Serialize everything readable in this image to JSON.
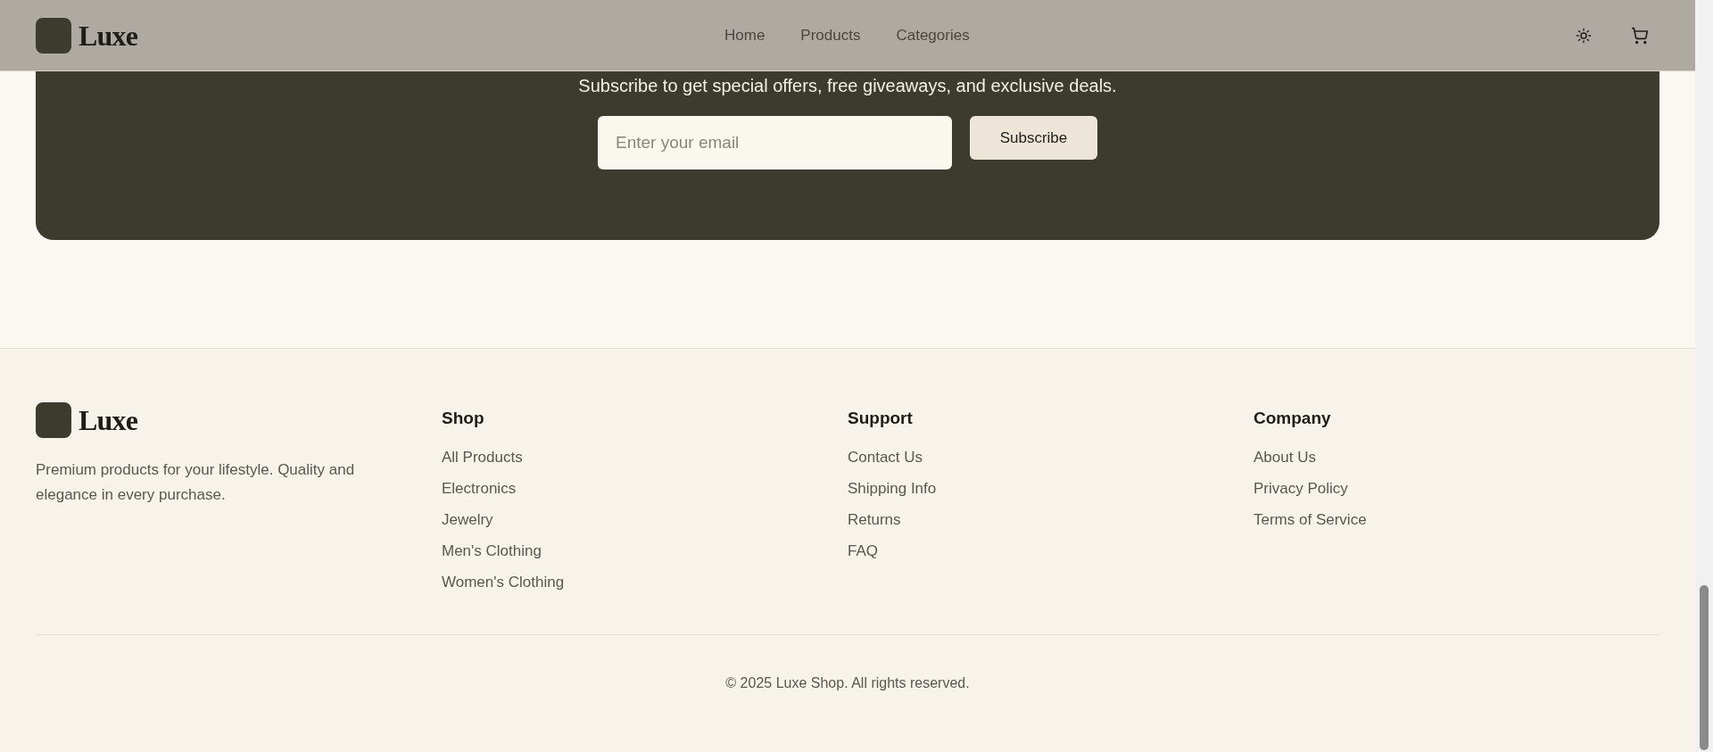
{
  "header": {
    "logo": "Luxe",
    "nav": [
      {
        "label": "Home"
      },
      {
        "label": "Products"
      },
      {
        "label": "Categories"
      }
    ]
  },
  "newsletter": {
    "subtitle": "Subscribe to get special offers, free giveaways, and exclusive deals.",
    "email": {
      "placeholder": "Enter your email"
    },
    "button": "Subscribe"
  },
  "footer": {
    "logo": "Luxe",
    "description": "Premium products for your lifestyle. Quality and elegance in every purchase.",
    "columns": [
      {
        "title": "Shop",
        "links": [
          "All Products",
          "Electronics",
          "Jewelry",
          "Men's Clothing",
          "Women's Clothing"
        ]
      },
      {
        "title": "Support",
        "links": [
          "Contact Us",
          "Shipping Info",
          "Returns",
          "FAQ"
        ]
      },
      {
        "title": "Company",
        "links": [
          "About Us",
          "Privacy Policy",
          "Terms of Service"
        ]
      }
    ],
    "copyright": "© 2025 Luxe Shop. All rights reserved."
  }
}
